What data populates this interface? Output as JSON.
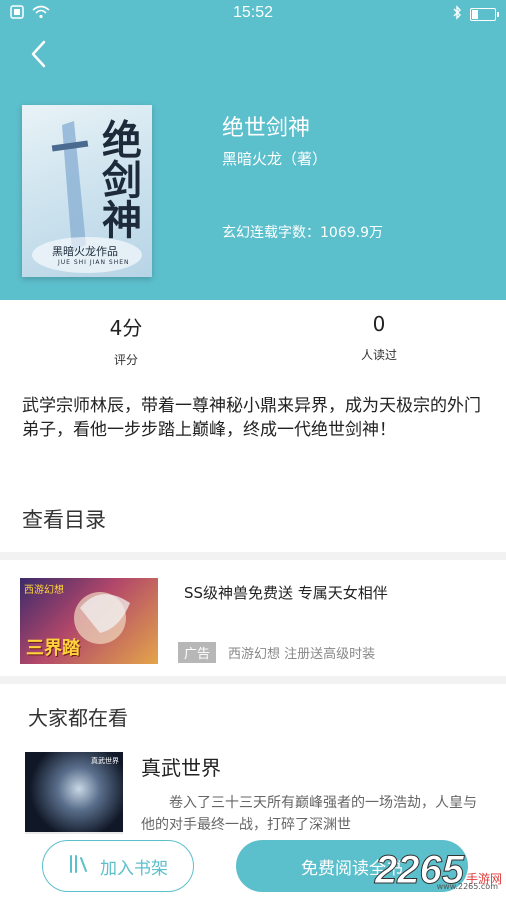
{
  "status_bar": {
    "time": "15:52"
  },
  "book": {
    "title": "绝世剑神",
    "author": "黑暗火龙（著）",
    "meta_category": "玄幻连载字数：",
    "meta_words": "1069.9万",
    "cover": {
      "title": "绝剑神",
      "author": "黑暗火龙作品",
      "subtitle": "JUE SHI JIAN SHEN"
    }
  },
  "stats": [
    {
      "value": "4分",
      "label": "评分"
    },
    {
      "value": "0",
      "label": "人读过"
    }
  ],
  "summary": "武学宗师林辰，带着一尊神秘小鼎来异界，成为天极宗的外门弟子，看他一步步踏上巅峰，终成一代绝世剑神！",
  "toc": {
    "label": "查看目录"
  },
  "ad": {
    "title": "SS级神兽免费送 专属天女相伴",
    "badge": "广告",
    "desc": "西游幻想 注册送高级时装",
    "image_text": "三界踏",
    "image_top": "西游幻想"
  },
  "popular": {
    "title": "大家都在看",
    "items": [
      {
        "name": "真武世界",
        "desc": "卷入了三十三天所有巅峰强者的一场浩劫，人皇与他的对手最终一战，打碎了深渊世",
        "cover_text": "真武世界"
      }
    ]
  },
  "bottom": {
    "shelf_label": "加入书架",
    "read_label": "免费阅读全书"
  },
  "watermark": {
    "number": "2265",
    "text": "手游网",
    "url": "www.2265.com"
  },
  "colors": {
    "accent": "#5cbfcc"
  }
}
